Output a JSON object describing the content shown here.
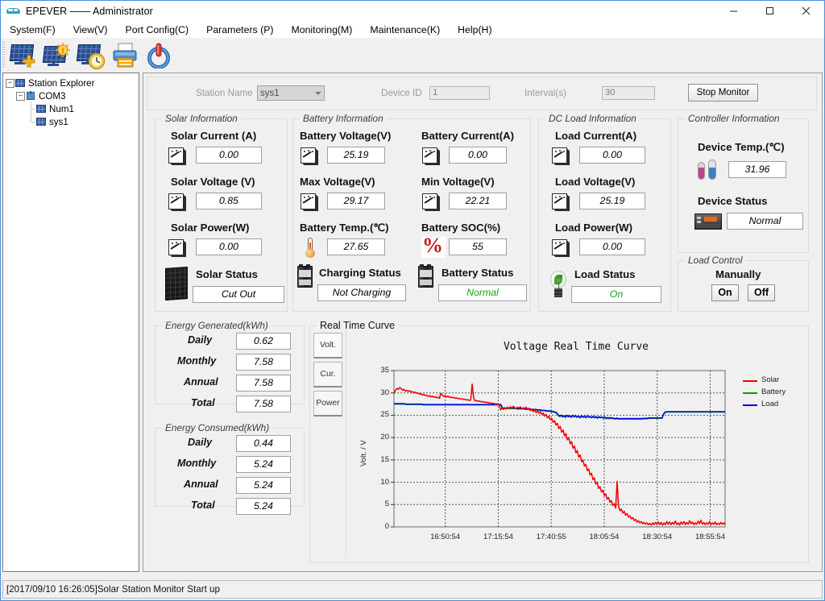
{
  "window": {
    "title": "EPEVER —— Administrator",
    "icon": "epever-logo-icon",
    "minimize": "─",
    "maximize": "☐",
    "close": "✕"
  },
  "menubar": {
    "items": [
      {
        "label": "System(F)"
      },
      {
        "label": "View(V)"
      },
      {
        "label": "Port Config(C)"
      },
      {
        "label": "Parameters (P)"
      },
      {
        "label": "Monitoring(M)"
      },
      {
        "label": "Maintenance(K)"
      },
      {
        "label": "Help(H)"
      }
    ]
  },
  "toolbar": {
    "buttons": [
      {
        "name": "add-station-icon",
        "tip": "Add Station"
      },
      {
        "name": "monitor-station-icon",
        "tip": "Monitor"
      },
      {
        "name": "history-data-icon",
        "tip": "History"
      },
      {
        "name": "print-icon",
        "tip": "Print"
      },
      {
        "name": "power-icon",
        "tip": "Exit"
      }
    ]
  },
  "tree": {
    "root": "Station Explorer",
    "com": "COM3",
    "children": [
      "Num1",
      "sys1"
    ]
  },
  "station_bar": {
    "station_name_label": "Station Name",
    "station_name_value": "sys1",
    "device_id_label": "Device ID",
    "device_id_value": "1",
    "interval_label": "Interval(s)",
    "interval_value": "30",
    "monitor_button": "Stop Monitor"
  },
  "solar": {
    "caption": "Solar Information",
    "fields": [
      {
        "title": "Solar Current (A)",
        "value": "0.00",
        "icon": "meter-icon"
      },
      {
        "title": "Solar Voltage (V)",
        "value": "0.85",
        "icon": "meter-icon"
      },
      {
        "title": "Solar Power(W)",
        "value": "0.00",
        "icon": "meter-icon"
      }
    ],
    "status_title": "Solar Status",
    "status_value": "Cut Out",
    "status_icon": "solar-module-icon"
  },
  "battery": {
    "caption": "Battery Information",
    "fields": [
      {
        "title": "Battery Voltage(V)",
        "value": "25.19",
        "icon": "meter-icon"
      },
      {
        "title": "Battery Current(A)",
        "value": "0.00",
        "icon": "meter-icon"
      },
      {
        "title": "Max Voltage(V)",
        "value": "29.17",
        "icon": "meter-icon"
      },
      {
        "title": "Min Voltage(V)",
        "value": "22.21",
        "icon": "meter-icon"
      },
      {
        "title": "Battery Temp.(℃)",
        "value": "27.65",
        "icon": "thermometer-icon"
      },
      {
        "title": "Battery SOC(%)",
        "value": "55",
        "icon": "percent-icon"
      }
    ],
    "charging_title": "Charging Status",
    "charging_value": "Not Charging",
    "battery_title": "Battery Status",
    "battery_value": "Normal",
    "status_icon": "battery-icon"
  },
  "dcload": {
    "caption": "DC Load Information",
    "fields": [
      {
        "title": "Load Current(A)",
        "value": "0.00",
        "icon": "meter-icon"
      },
      {
        "title": "Load Voltage(V)",
        "value": "25.19",
        "icon": "meter-icon"
      },
      {
        "title": "Load Power(W)",
        "value": "0.00",
        "icon": "meter-icon"
      }
    ],
    "status_title": "Load Status",
    "status_value": "On",
    "status_icon": "light-bulb-icon"
  },
  "controller": {
    "caption": "Controller Information",
    "temp_title": "Device Temp.(℃)",
    "temp_value": "31.96",
    "temp_icon": "dual-thermometer-icon",
    "status_title": "Device Status",
    "status_value": "Normal",
    "status_icon": "controller-icon"
  },
  "load_control": {
    "caption": "Load Control",
    "mode_title": "Manually",
    "on_button": "On",
    "off_button": "Off"
  },
  "energy_generated": {
    "caption": "Energy Generated(kWh)",
    "rows": [
      {
        "label": "Daily",
        "value": "0.62"
      },
      {
        "label": "Monthly",
        "value": "7.58"
      },
      {
        "label": "Annual",
        "value": "7.58"
      },
      {
        "label": "Total",
        "value": "7.58"
      }
    ]
  },
  "energy_consumed": {
    "caption": "Energy Consumed(kWh)",
    "rows": [
      {
        "label": "Daily",
        "value": "0.44"
      },
      {
        "label": "Monthly",
        "value": "5.24"
      },
      {
        "label": "Annual",
        "value": "5.24"
      },
      {
        "label": "Total",
        "value": "5.24"
      }
    ]
  },
  "curve_panel": {
    "caption": "Real Time Curve",
    "tabs": [
      {
        "label": "Volt.",
        "selected": true
      },
      {
        "label": "Cur.",
        "selected": false
      },
      {
        "label": "Power",
        "selected": false
      }
    ]
  },
  "statusbar": {
    "text": "[2017/09/10 16:26:05]Solar Station Monitor Start up"
  },
  "chart_data": {
    "type": "line",
    "title": "Voltage Real Time Curve",
    "xlabel": "",
    "ylabel": "Volt. / V",
    "ylim": [
      0,
      35
    ],
    "yticks": [
      0,
      5,
      10,
      15,
      20,
      25,
      30,
      35
    ],
    "xticks": [
      "16:50:54",
      "17:15:54",
      "17:40:55",
      "18:05:54",
      "18:30:54",
      "18:55:54"
    ],
    "xtick_positions": [
      0.155,
      0.315,
      0.475,
      0.635,
      0.795,
      0.955
    ],
    "grid": true,
    "legend_position": "right",
    "colors": {
      "solar": "#ee0000",
      "battery": "#00a000",
      "load": "#0000ee"
    },
    "series": [
      {
        "name": "Solar",
        "color": "#ee0000",
        "values": [
          29.9,
          30.6,
          31.0,
          30.8,
          31.2,
          31.0,
          30.6,
          30.8,
          30.4,
          30.6,
          30.3,
          30.5,
          30.2,
          30.3,
          30.0,
          30.2,
          29.9,
          30.0,
          29.7,
          29.8,
          29.5,
          29.7,
          29.4,
          29.5,
          29.2,
          29.4,
          29.1,
          29.3,
          29.0,
          29.2,
          28.9,
          29.0,
          28.8,
          29.9,
          29.5,
          29.2,
          29.4,
          29.1,
          29.3,
          29.0,
          29.1,
          28.9,
          29.0,
          28.8,
          28.9,
          28.7,
          28.8,
          28.6,
          28.7,
          28.5,
          28.6,
          28.4,
          28.5,
          28.3,
          28.4,
          32.0,
          29.0,
          28.2,
          28.3,
          28.1,
          28.2,
          28.0,
          28.1,
          27.9,
          28.0,
          27.8,
          27.9,
          27.7,
          27.8,
          27.6,
          27.7,
          27.5,
          27.6,
          27.4,
          27.5,
          26.2,
          26.6,
          26.3,
          26.7,
          26.4,
          26.8,
          26.5,
          26.9,
          26.6,
          27.0,
          26.7,
          26.5,
          26.8,
          26.6,
          26.9,
          26.4,
          26.7,
          26.5,
          26.8,
          26.3,
          26.6,
          26.0,
          26.4,
          25.8,
          26.2,
          25.6,
          26.0,
          25.4,
          25.8,
          25.2,
          25.5,
          24.8,
          25.2,
          24.4,
          24.8,
          24.0,
          24.3,
          23.4,
          23.8,
          22.8,
          23.2,
          22.0,
          22.5,
          21.2,
          21.7,
          20.4,
          20.9,
          19.5,
          20.0,
          18.6,
          19.1,
          17.6,
          18.1,
          16.6,
          17.1,
          15.6,
          16.1,
          14.6,
          15.0,
          13.6,
          14.0,
          12.6,
          13.0,
          11.6,
          12.0,
          10.6,
          11.0,
          9.6,
          10.0,
          8.6,
          9.0,
          7.8,
          8.2,
          7.0,
          7.4,
          6.2,
          6.6,
          5.5,
          5.9,
          4.8,
          5.2,
          4.2,
          10.2,
          4.6,
          3.6,
          4.0,
          3.1,
          3.5,
          2.6,
          3.0,
          2.2,
          2.5,
          1.8,
          2.1,
          1.4,
          1.7,
          1.1,
          1.4,
          0.9,
          1.2,
          0.7,
          1.0,
          0.6,
          0.9,
          0.5,
          0.8,
          0.4,
          0.9,
          0.5,
          1.0,
          0.6,
          1.1,
          0.5,
          1.0,
          0.4,
          0.9,
          0.5,
          1.2,
          0.6,
          1.1,
          0.5,
          1.0,
          0.6,
          1.3,
          0.5,
          0.9,
          0.4,
          1.1,
          0.6,
          1.2,
          0.5,
          1.0,
          0.6,
          1.4,
          0.7,
          1.1,
          0.5,
          0.9,
          0.6,
          1.3,
          0.7,
          1.5,
          0.6,
          1.0,
          0.5,
          0.9,
          0.6,
          1.2,
          0.5,
          0.9,
          0.6,
          1.1,
          0.5,
          0.8,
          0.5,
          1.0,
          0.6,
          0.9,
          0.5
        ]
      },
      {
        "name": "Battery",
        "color": "#00a000",
        "values": [
          27.5,
          27.5,
          27.5,
          27.5,
          27.5,
          27.5,
          27.5,
          27.5,
          27.4,
          27.4,
          27.4,
          27.4,
          27.4,
          27.4,
          27.4,
          27.4,
          27.4,
          27.4,
          27.4,
          27.4,
          27.3,
          27.3,
          27.3,
          27.3,
          27.3,
          27.3,
          27.3,
          27.3,
          27.3,
          27.3,
          27.3,
          27.3,
          27.3,
          27.3,
          27.3,
          27.3,
          27.3,
          27.3,
          27.3,
          27.3,
          27.3,
          27.3,
          27.3,
          27.3,
          27.3,
          27.3,
          27.3,
          27.3,
          27.3,
          27.3,
          27.3,
          27.3,
          27.3,
          27.3,
          27.3,
          27.3,
          27.3,
          27.3,
          27.3,
          27.3,
          27.3,
          27.3,
          27.3,
          27.3,
          27.3,
          27.3,
          27.3,
          27.3,
          27.3,
          27.3,
          27.3,
          27.3,
          27.3,
          27.3,
          26.5,
          26.5,
          26.5,
          26.5,
          26.5,
          26.5,
          26.5,
          26.5,
          26.5,
          26.5,
          26.4,
          26.4,
          26.4,
          26.4,
          26.4,
          26.4,
          26.3,
          26.3,
          26.3,
          26.3,
          26.2,
          26.2,
          26.2,
          26.2,
          26.1,
          26.1,
          26.1,
          26.0,
          26.0,
          26.0,
          25.9,
          25.9,
          25.9,
          25.8,
          25.8,
          25.7,
          25.6,
          25.5,
          25.0,
          24.7,
          24.9,
          24.6,
          24.8,
          24.5,
          24.9,
          24.6,
          24.8,
          24.5,
          24.9,
          24.6,
          24.8,
          24.5,
          24.7,
          24.4,
          24.8,
          24.5,
          24.7,
          24.4,
          24.8,
          24.5,
          24.6,
          24.4,
          24.7,
          24.4,
          24.6,
          24.3,
          24.6,
          24.4,
          24.5,
          24.3,
          24.5,
          24.2,
          24.4,
          24.2,
          24.4,
          24.2,
          24.3,
          24.1,
          24.3,
          24.1,
          24.2,
          24.1,
          24.2,
          24.1,
          24.2,
          24.1,
          24.2,
          24.1,
          24.2,
          24.1,
          24.2,
          24.1,
          24.2,
          24.1,
          24.2,
          24.1,
          24.2,
          24.2,
          24.2,
          24.2,
          24.3,
          24.3,
          24.3,
          24.3,
          24.3,
          24.3,
          24.3,
          24.3,
          24.3,
          24.3,
          25.2,
          25.6,
          25.7,
          25.7,
          25.7,
          25.7,
          25.7,
          25.7,
          25.7,
          25.7,
          25.7,
          25.7,
          25.7,
          25.7,
          25.7,
          25.7,
          25.7,
          25.7,
          25.7,
          25.7,
          25.7,
          25.7,
          25.7,
          25.7,
          25.7,
          25.7,
          25.7,
          25.7,
          25.7,
          25.7,
          25.7,
          25.7,
          25.7,
          25.7,
          25.7,
          25.7,
          25.7,
          25.7,
          25.7,
          25.7,
          25.7,
          25.7,
          25.7
        ]
      },
      {
        "name": "Load",
        "color": "#0000ee",
        "values": [
          27.6,
          27.6,
          27.6,
          27.6,
          27.6,
          27.6,
          27.6,
          27.6,
          27.5,
          27.5,
          27.5,
          27.5,
          27.5,
          27.5,
          27.5,
          27.5,
          27.5,
          27.5,
          27.5,
          27.5,
          27.4,
          27.4,
          27.4,
          27.4,
          27.4,
          27.4,
          27.4,
          27.4,
          27.4,
          27.4,
          27.4,
          27.4,
          27.4,
          27.4,
          27.4,
          27.4,
          27.4,
          27.4,
          27.4,
          27.4,
          27.4,
          27.4,
          27.4,
          27.4,
          27.4,
          27.4,
          27.4,
          27.4,
          27.4,
          27.4,
          27.4,
          27.4,
          27.4,
          27.4,
          27.4,
          27.4,
          27.4,
          27.4,
          27.4,
          27.4,
          27.4,
          27.4,
          27.4,
          27.4,
          27.4,
          27.4,
          27.4,
          27.4,
          27.4,
          27.4,
          27.4,
          27.4,
          27.4,
          27.4,
          26.6,
          26.6,
          26.6,
          26.6,
          26.6,
          26.6,
          26.6,
          26.6,
          26.6,
          26.6,
          26.5,
          26.5,
          26.5,
          26.5,
          26.5,
          26.5,
          26.4,
          26.4,
          26.4,
          26.4,
          26.3,
          26.3,
          26.3,
          26.3,
          26.2,
          26.2,
          26.2,
          26.1,
          26.1,
          26.1,
          26.0,
          26.0,
          26.0,
          25.9,
          25.9,
          25.8,
          25.7,
          25.6,
          25.1,
          24.8,
          25.0,
          24.7,
          24.9,
          24.6,
          25.0,
          24.7,
          24.9,
          24.6,
          25.0,
          24.7,
          24.9,
          24.6,
          24.8,
          24.5,
          24.9,
          24.6,
          24.8,
          24.5,
          24.9,
          24.6,
          24.7,
          24.5,
          24.8,
          24.5,
          24.7,
          24.4,
          24.7,
          24.5,
          24.6,
          24.4,
          24.6,
          24.3,
          24.5,
          24.3,
          24.5,
          24.3,
          24.4,
          24.2,
          24.4,
          24.2,
          24.3,
          24.2,
          24.3,
          24.2,
          24.3,
          24.2,
          24.3,
          24.2,
          24.3,
          24.2,
          24.3,
          24.2,
          24.3,
          24.2,
          24.3,
          24.2,
          24.3,
          24.3,
          24.3,
          24.3,
          24.4,
          24.4,
          24.4,
          24.4,
          24.4,
          24.4,
          24.4,
          24.4,
          24.4,
          24.4,
          25.3,
          25.7,
          25.8,
          25.8,
          25.8,
          25.8,
          25.8,
          25.8,
          25.8,
          25.8,
          25.8,
          25.8,
          25.8,
          25.8,
          25.8,
          25.8,
          25.8,
          25.8,
          25.8,
          25.8,
          25.8,
          25.8,
          25.8,
          25.8,
          25.8,
          25.8,
          25.8,
          25.8,
          25.8,
          25.8,
          25.8,
          25.8,
          25.8,
          25.8,
          25.8,
          25.8,
          25.8,
          25.8,
          25.8,
          25.8,
          25.8,
          25.8,
          25.8
        ]
      }
    ]
  }
}
